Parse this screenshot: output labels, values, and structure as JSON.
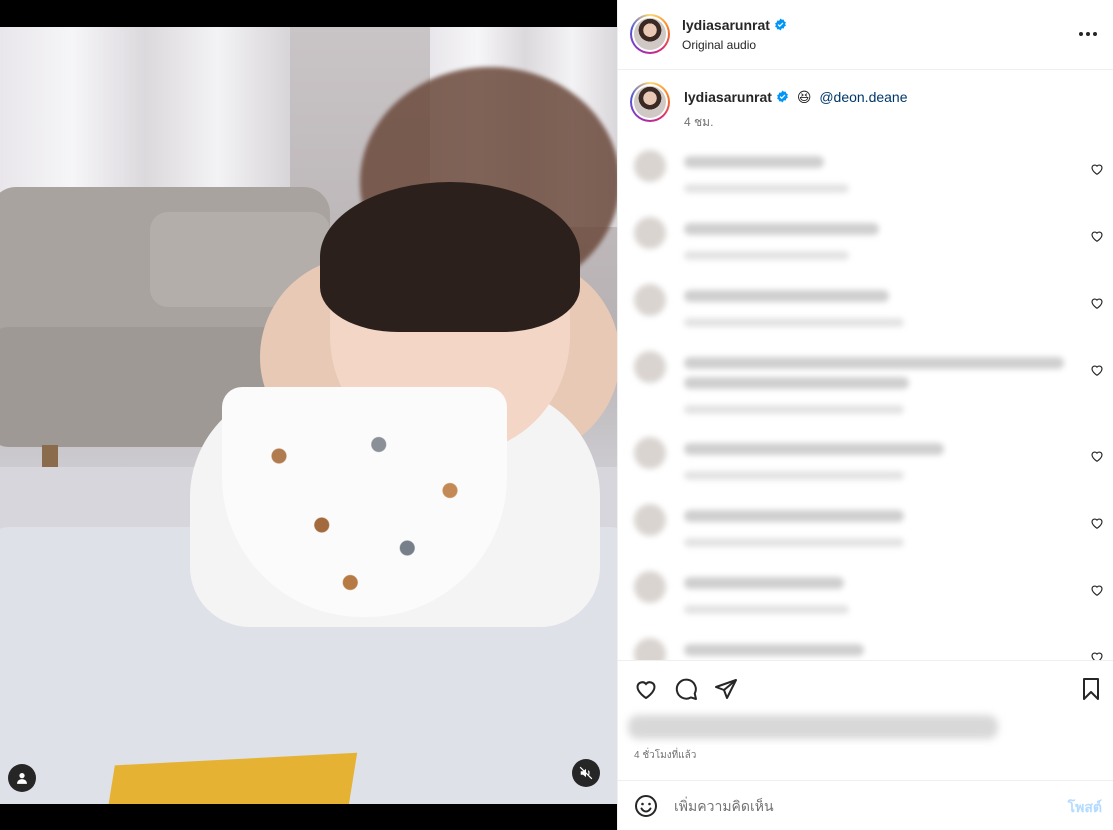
{
  "post": {
    "author": "lydiasarunrat",
    "audio_label": "Original audio"
  },
  "caption": {
    "author": "lydiasarunrat",
    "emoji": "😆",
    "mention": "@deon.deane",
    "time": "4 ชม."
  },
  "comments_count_visible": 8,
  "footer": {
    "time_ago": "4 ชั่วโมงที่แล้ว",
    "comment_placeholder": "เพิ่มความคิดเห็น",
    "post_label": "โพสต์"
  },
  "colors": {
    "verified": "#0095f6",
    "mention": "#00376b",
    "post_button": "#b3dbff"
  },
  "icons": {
    "more": "more-horizontal-icon",
    "like": "heart-icon",
    "comment": "comment-icon",
    "share": "share-icon",
    "save": "bookmark-icon",
    "emoji": "emoji-icon",
    "user": "user-icon",
    "mute": "mute-icon"
  }
}
